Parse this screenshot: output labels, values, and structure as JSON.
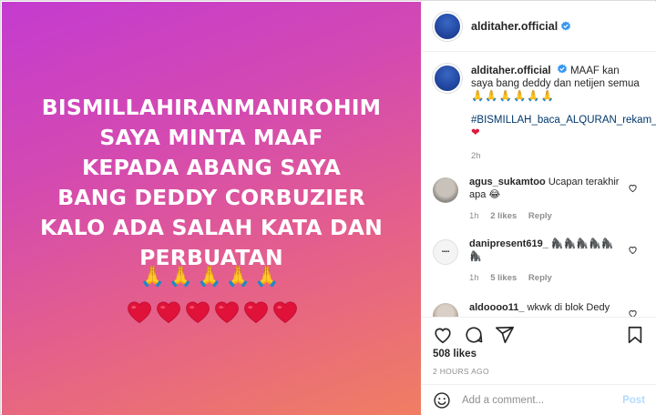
{
  "post_image": {
    "lines": [
      "BISMILLAHIRANMANIROHIM",
      "SAYA MINTA MAAF",
      "KEPADA ABANG SAYA",
      "BANG DEDDY CORBUZIER",
      "KALO ADA SALAH KATA DAN",
      "PERBUATAN"
    ],
    "hands": "🙏🙏🙏🙏🙏",
    "heart_count": 6,
    "gradient_colors": [
      "#c43bd0",
      "#f07e62"
    ]
  },
  "header": {
    "username": "alditaher.official",
    "verified": true
  },
  "caption": {
    "username": "alditaher.official",
    "text": "MAAF kan saya bang deddy dan netijen semua",
    "hands": "🙏🙏🙏🙏🙏🙏",
    "hashtags": "#BISMILLAH_baca_ALQURAN_rekam_POSTING",
    "heart": "❤",
    "time": "2h"
  },
  "comments": [
    {
      "username": "agus_sukamtoo",
      "text": "Ucapan terakhir apa",
      "emoji": "😂",
      "time": "1h",
      "likes": "2 likes",
      "reply": "Reply"
    },
    {
      "username": "danipresent619_",
      "text": "🦍🦍🦍🦍🦍🦍",
      "emoji": "",
      "time": "1h",
      "likes": "5 likes",
      "reply": "Reply"
    },
    {
      "username": "aldoooo11_",
      "text": "wkwk di blok Dedy",
      "emoji": "",
      "time": "",
      "likes": "",
      "reply": ""
    }
  ],
  "actions": {
    "likes": "508 likes",
    "ago": "2 HOURS AGO"
  },
  "add_comment": {
    "placeholder": "Add a comment...",
    "post_label": "Post"
  },
  "colors": {
    "link": "#00376b",
    "verified": "#3897f0",
    "post_disabled": "#b3dbff"
  }
}
